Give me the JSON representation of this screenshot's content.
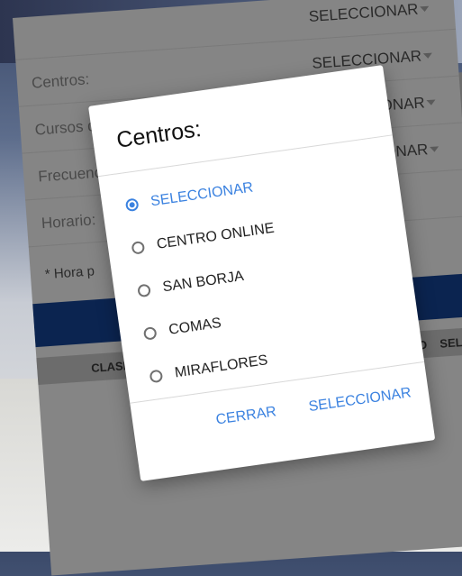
{
  "form": {
    "rows": [
      {
        "label": "",
        "value": "SELECCIONAR"
      },
      {
        "label": "Centros:",
        "value": "SELECCIONAR"
      },
      {
        "label": "Cursos disponibles:",
        "value": "SELECCIONAR"
      },
      {
        "label": "Frecuencia:",
        "value": "SELECCIONAR"
      },
      {
        "label": "Horario:",
        "value": ""
      }
    ],
    "note": "* Hora p",
    "table_headers": [
      "CLASE",
      "ECIO",
      "SEL"
    ]
  },
  "dialog": {
    "title": "Centros:",
    "options": [
      {
        "label": "SELECCIONAR",
        "selected": true
      },
      {
        "label": "CENTRO ONLINE",
        "selected": false
      },
      {
        "label": "SAN BORJA",
        "selected": false
      },
      {
        "label": "COMAS",
        "selected": false
      },
      {
        "label": "MIRAFLORES",
        "selected": false
      }
    ],
    "cancel_label": "CERRAR",
    "confirm_label": "SELECCIONAR"
  },
  "colors": {
    "accent": "#3b82e0",
    "header_bar": "#0b2450",
    "overlay": "#858585"
  }
}
